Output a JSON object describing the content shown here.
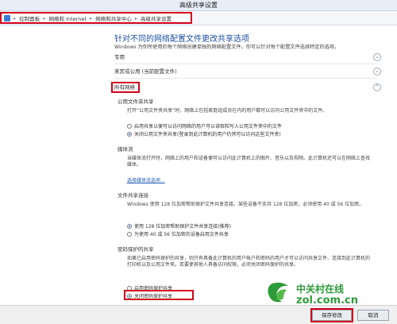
{
  "window": {
    "title": "高级共享设置"
  },
  "address_bar": {
    "crumbs": [
      "控制面板",
      "网络和 Internet",
      "网络和共享中心",
      "高级共享设置"
    ],
    "separator": "▸"
  },
  "main": {
    "title": "针对不同的网络配置文件更改共享选项",
    "description": "Windows 为你所使用的每个网络创建单独的网络配置文件。你可以针对每个配置文件选择特定的选项。",
    "profiles": [
      {
        "label": "专用",
        "chevron": "⌄"
      },
      {
        "label": "来宾或公用 (当前配置文件)",
        "chevron": "⌄"
      },
      {
        "label": "所有网络",
        "chevron": "⌃"
      }
    ]
  },
  "public_folder_sharing": {
    "title": "公用文件夹共享",
    "paragraph": "打开“公用文件夹共享”时，网络上包括家庭组成员在内的用户都可以访问公用文件夹中的文件。",
    "options": [
      {
        "label": "启用共享以便可以访问网络的用户可以读取和写入公用文件夹中的文件",
        "selected": false
      },
      {
        "label": "关闭公用文件夹共享(登录到此计算机的用户仍然可以访问这些文件夹)",
        "selected": true
      }
    ]
  },
  "media_streaming": {
    "title": "媒体流",
    "paragraph": "当媒体流打开时，网络上的用户和设备便可以访问此计算机上的图片、音乐以及视频。此计算机还可以在网络上查找媒体。",
    "link": "选择媒体流选项..."
  },
  "file_sharing_connection": {
    "title": "文件共享连接",
    "paragraph": "Windows 使用 128 位加密帮助保护文件共享连接。某些设备不支持 128 位加密，必须使用 40 或 56 位加密。",
    "options": [
      {
        "label": "使用 128 位加密帮助保护文件共享连接(推荐)",
        "selected": true
      },
      {
        "label": "为使用 40 或 56 位加密的设备启用文件共享",
        "selected": false
      }
    ]
  },
  "password_sharing": {
    "title": "密码保护的共享",
    "paragraph": "如果已启用密码保护的共享，则只有具备此计算机的用户帐户和密码的用户才可以访问共享文件、连接到此计算机的打印机以及公用文件夹。若要使其他人具备访问权限，必须关闭密码保护的共享。",
    "options": [
      {
        "label": "启用密码保护共享",
        "selected": false
      },
      {
        "label": "关闭密码保护共享",
        "selected": true
      }
    ]
  },
  "footer": {
    "save_label": "保存修改",
    "cancel_label": "取消"
  },
  "watermark": {
    "line1": "中关村在线",
    "line2": "zol.com.cn"
  },
  "colors": {
    "highlight": "#d0021b",
    "link": "#1e5ab4",
    "title": "#1e4fa0",
    "watermark_green": "#2e9b3a"
  }
}
